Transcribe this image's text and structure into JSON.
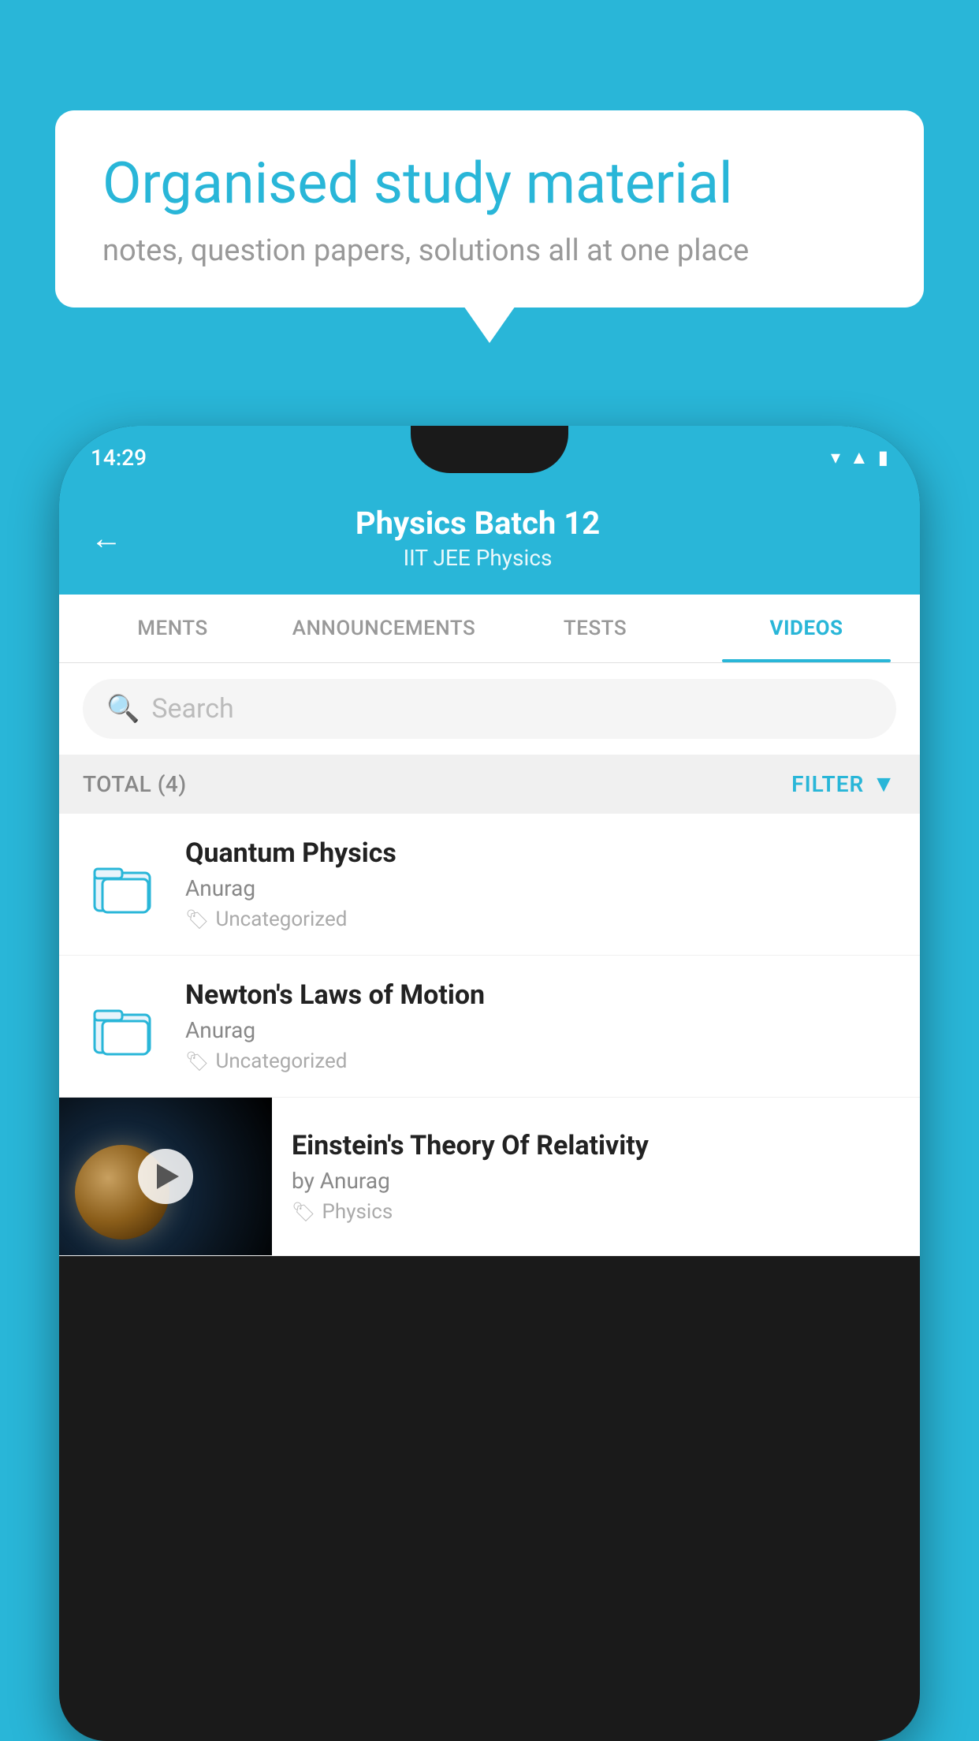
{
  "background": {
    "color": "#29B6D8"
  },
  "speech_bubble": {
    "title": "Organised study material",
    "subtitle": "notes, question papers, solutions all at one place"
  },
  "phone": {
    "status_bar": {
      "time": "14:29"
    },
    "header": {
      "title": "Physics Batch 12",
      "subtitle": "IIT JEE   Physics",
      "back_label": "←"
    },
    "tabs": [
      {
        "label": "MENTS",
        "active": false
      },
      {
        "label": "ANNOUNCEMENTS",
        "active": false
      },
      {
        "label": "TESTS",
        "active": false
      },
      {
        "label": "VIDEOS",
        "active": true
      }
    ],
    "search": {
      "placeholder": "Search"
    },
    "filter": {
      "total_label": "TOTAL (4)",
      "filter_label": "FILTER"
    },
    "videos": [
      {
        "title": "Quantum Physics",
        "author": "Anurag",
        "tag": "Uncategorized",
        "type": "folder"
      },
      {
        "title": "Newton's Laws of Motion",
        "author": "Anurag",
        "tag": "Uncategorized",
        "type": "folder"
      },
      {
        "title": "Einstein's Theory Of Relativity",
        "author": "by Anurag",
        "tag": "Physics",
        "type": "thumb"
      }
    ]
  }
}
